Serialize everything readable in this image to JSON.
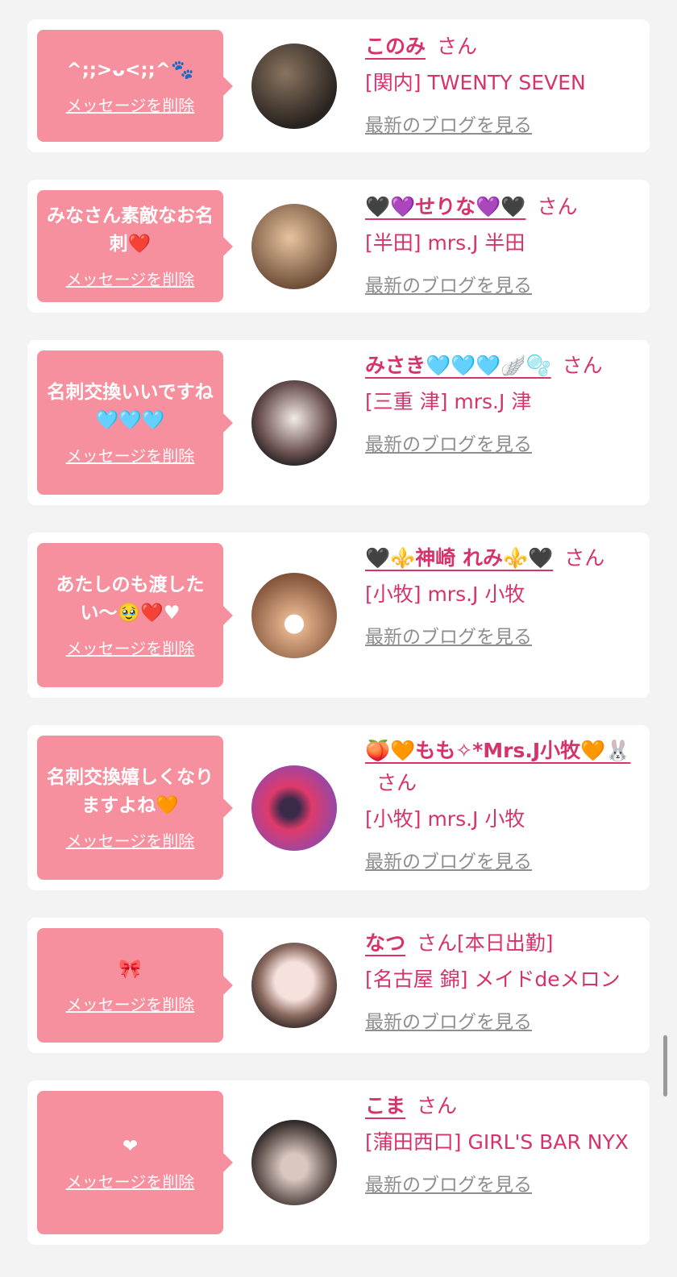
{
  "cards": [
    {
      "message": "^;;>ᴗ<;;^🐾",
      "delete_label": "メッセージを削除",
      "name": "このみ",
      "honorific": "さん",
      "shop": "[関内] TWENTY SEVEN",
      "blog_label": "最新のブログを見る",
      "avatar_colors": [
        "#6b5a4a",
        "#2a2a2a"
      ]
    },
    {
      "message": "みなさん素敵なお名刺❤️",
      "delete_label": "メッセージを削除",
      "name": "🖤💜せりな💜🖤",
      "honorific": "さん",
      "shop": "[半田] mrs.J 半田",
      "blog_label": "最新のブログを見る",
      "avatar_colors": [
        "#d9b890",
        "#7a5a40"
      ]
    },
    {
      "message": "名刺交換いいですね🩵🩵🩵",
      "delete_label": "メッセージを削除",
      "name": "みさき🩵🩵🩵🪽🫧",
      "honorific": "さん",
      "shop": "[三重 津] mrs.J 津",
      "blog_label": "最新のブログを見る",
      "avatar_colors": [
        "#f0e6e0",
        "#202020"
      ]
    },
    {
      "message": "あたしのも渡したい〜🥹❤️♥",
      "delete_label": "メッセージを削除",
      "name": "🖤⚜️神崎 れみ⚜️🖤",
      "honorific": "さん",
      "shop": "[小牧] mrs.J 小牧",
      "blog_label": "最新のブログを見る",
      "avatar_colors": [
        "#e0b08a",
        "#5a3a2a"
      ]
    },
    {
      "message": "名刺交換嬉しくなりますよね🧡",
      "delete_label": "メッセージを削除",
      "name": "🍑🧡もも✧*Mrs.J小牧🧡🐰",
      "honorific": "さん",
      "shop": "[小牧] mrs.J 小牧",
      "blog_label": "最新のブログを見る",
      "avatar_colors": [
        "#e03a6a",
        "#6a3aa0"
      ]
    },
    {
      "message": "🎀",
      "delete_label": "メッセージを削除",
      "name": "なつ",
      "honorific": "さん[本日出勤]",
      "shop": "[名古屋 錦] メイドdeメロン",
      "blog_label": "最新のブログを見る",
      "avatar_colors": [
        "#f2d8d4",
        "#3a2a2a"
      ]
    },
    {
      "message": "❤",
      "delete_label": "メッセージを削除",
      "name": "こま",
      "honorific": "さん",
      "shop": "[蒲田西口] GIRL'S BAR NYX",
      "blog_label": "最新のブログを見る",
      "avatar_colors": [
        "#c8b8b0",
        "#1a1a1a"
      ]
    }
  ],
  "colors": {
    "accent": "#d6336c",
    "bubble": "#f7909e",
    "link_gray": "#8e8e8e"
  }
}
